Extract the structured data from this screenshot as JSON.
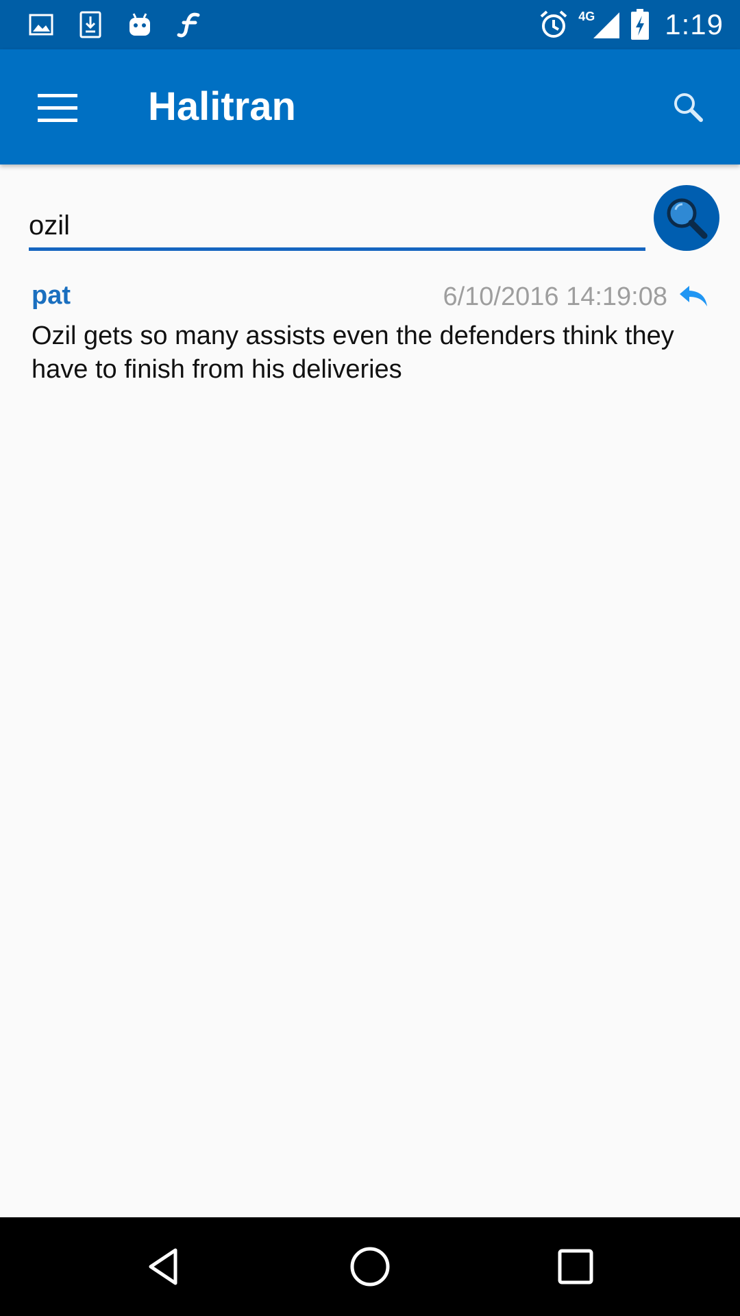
{
  "status_bar": {
    "time": "1:19",
    "network": "4G",
    "icons": [
      "image-icon",
      "download-icon",
      "android-icon",
      "flash-f-icon",
      "alarm-icon",
      "signal-icon",
      "battery-charging-icon"
    ]
  },
  "app_bar": {
    "title": "Halitran",
    "menu_icon": "menu-icon",
    "search_icon": "search-icon"
  },
  "search": {
    "value": "ozil",
    "button_icon": "search-icon"
  },
  "results": [
    {
      "user": "pat",
      "timestamp": "6/10/2016 14:19:08",
      "text": "Ozil gets so many assists even the defenders think they have to finish from his deliveries",
      "reply_icon": "reply-icon"
    }
  ],
  "nav_bar": {
    "buttons": [
      "back-icon",
      "home-icon",
      "recents-icon"
    ]
  },
  "colors": {
    "status_bar": "#005ea6",
    "app_bar": "#0070c3",
    "accent": "#1565c0",
    "username": "#1a6fbf",
    "timestamp": "#9e9e9e",
    "background": "#fafafa"
  }
}
